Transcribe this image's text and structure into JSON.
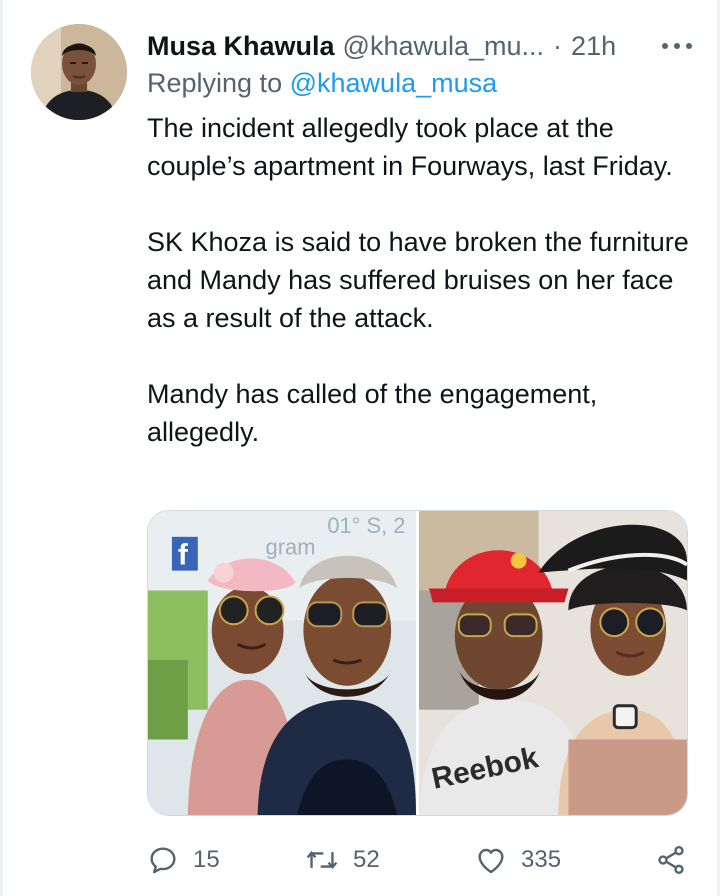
{
  "tweet": {
    "display_name": "Musa Khawula",
    "handle": "@khawula_mu...",
    "separator": "·",
    "timestamp": "21h",
    "reply_prefix": "Replying to",
    "reply_handle": "@khawula_musa",
    "paragraphs": [
      "The incident allegedly took place at the couple’s apartment in Fourways, last Friday.",
      "SK Khoza is said to have broken the furniture and Mandy has suffered bruises on her face as a result of the attack.",
      "Mandy has called of the engagement, allegedly."
    ]
  },
  "media": {
    "left_photo_text": [
      "f",
      "gram",
      "01° S, 2"
    ],
    "right_photo_text": [
      "Reebok"
    ]
  },
  "actions": {
    "reply_count": "15",
    "retweet_count": "52",
    "like_count": "335"
  },
  "icons": {
    "more": "more-horizontal-icon",
    "reply": "reply-icon",
    "retweet": "retweet-icon",
    "like": "heart-icon",
    "share": "share-icon"
  },
  "colors": {
    "text": "#0f1419",
    "secondary": "#536471",
    "link": "#1d9bf0",
    "border": "#cfd9de"
  }
}
